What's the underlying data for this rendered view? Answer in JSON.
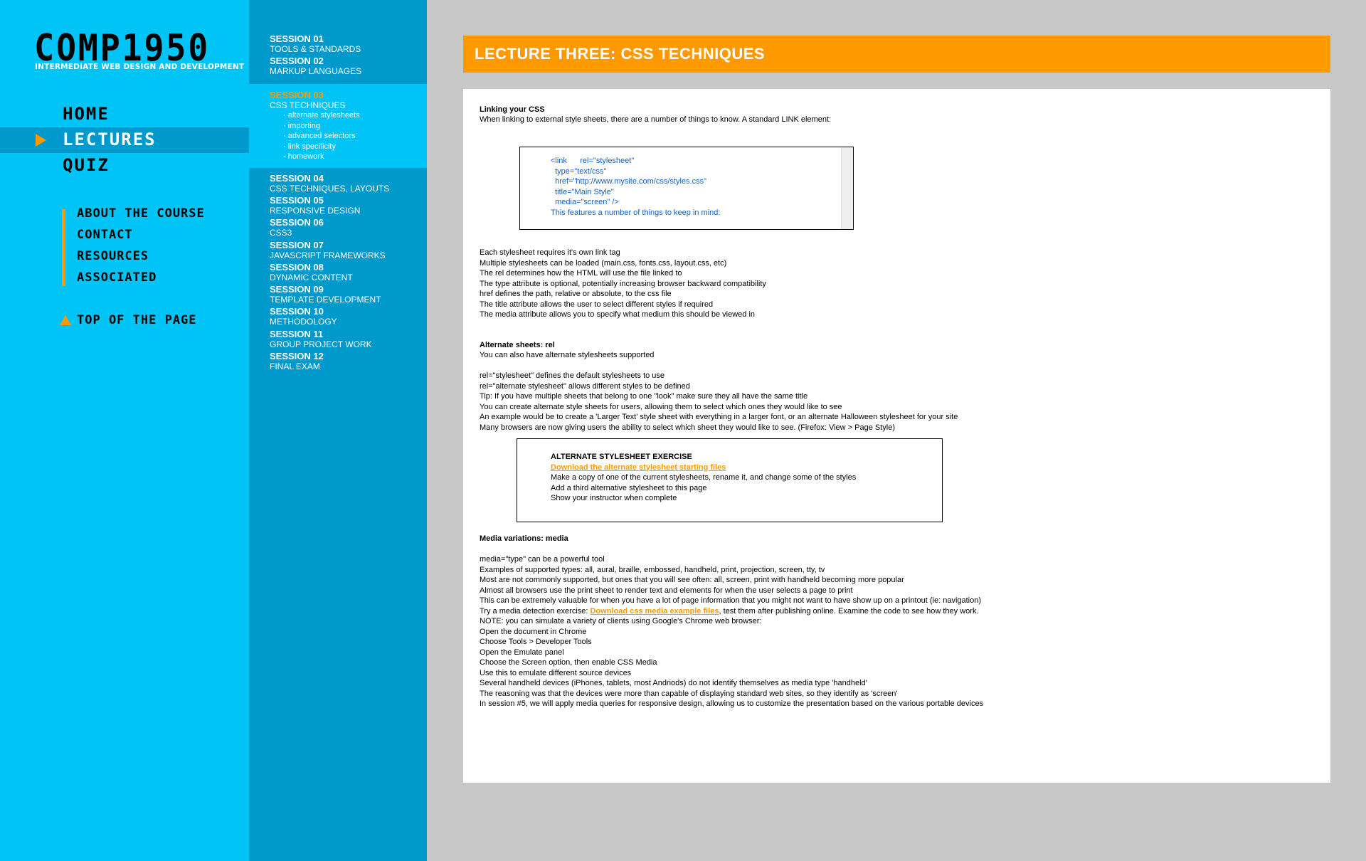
{
  "logo": {
    "title": "COMP1950",
    "subtitle": "INTERMEDIATE WEB DESIGN AND DEVELOPMENT"
  },
  "main_nav": [
    {
      "label": "HOME",
      "active": false
    },
    {
      "label": "LECTURES",
      "active": true
    },
    {
      "label": "QUIZ",
      "active": false
    }
  ],
  "sub_nav": [
    "ABOUT THE COURSE",
    "CONTACT",
    "RESOURCES",
    "ASSOCIATED"
  ],
  "top_link": "TOP OF THE PAGE",
  "sessions": [
    {
      "num": "SESSION 01",
      "name": "TOOLS & STANDARDS"
    },
    {
      "num": "SESSION 02",
      "name": "MARKUP LANGUAGES"
    },
    {
      "num": "SESSION 03",
      "name": "CSS TECHNIQUES"
    },
    {
      "num": "SESSION 04",
      "name": "CSS TECHNIQUES, LAYOUTS"
    },
    {
      "num": "SESSION 05",
      "name": "RESPONSIVE DESIGN"
    },
    {
      "num": "SESSION 06",
      "name": "CSS3"
    },
    {
      "num": "SESSION 07",
      "name": "JAVASCRIPT FRAMEWORKS"
    },
    {
      "num": "SESSION 08",
      "name": "DYNAMIC CONTENT"
    },
    {
      "num": "SESSION 09",
      "name": "TEMPLATE DEVELOPMENT"
    },
    {
      "num": "SESSION 10",
      "name": "METHODOLOGY"
    },
    {
      "num": "SESSION 11",
      "name": "GROUP PROJECT WORK"
    },
    {
      "num": "SESSION 12",
      "name": "FINAL EXAM"
    }
  ],
  "session_subtopics": [
    "· alternate stylesheets",
    "· importing",
    "· advanced selectors",
    "· link specificity",
    "- homework"
  ],
  "banner_title": "LECTURE THREE: CSS TECHNIQUES",
  "linking": {
    "heading": "Linking your CSS",
    "intro": "When linking to external style sheets, there are a number of things to know. A standard LINK element:",
    "code": [
      "<link      rel=\"stylesheet\"",
      "  type=\"text/css\"",
      "  href=\"http://www.mysite.com/css/styles.css\"",
      "  title=\"Main Style\"",
      "  media=\"screen\" />",
      "This features a number of things to keep in mind:"
    ],
    "points": [
      "Each stylesheet requires it's own link tag",
      "Multiple stylesheets can be loaded (main.css, fonts.css, layout.css, etc)",
      "The rel determines how the HTML will use the file linked to",
      "The type attribute is optional, potentially increasing browser backward compatibility",
      "href defines the path, relative or absolute, to the css file",
      "The title attribute allows the user to select different styles if required",
      "The media attribute allows you to specify what medium this should be viewed in"
    ]
  },
  "alternate": {
    "heading": "Alternate sheets: rel",
    "intro": "You can also have alternate stylesheets supported",
    "points": [
      "rel=\"stylesheet\" defines the default stylesheets to use",
      "rel=\"alternate stylesheet\" allows different styles to be defined",
      "Tip: If you have multiple sheets that belong to one \"look\" make sure they all have the same title",
      "You can create alternate style sheets for users, allowing them to select which ones they would like to see",
      "An example would be to create a 'Larger Text' style sheet with everything in a larger font, or an alternate Halloween stylesheet for your site",
      "Many browsers are now giving users the ability to select which sheet they would like to see. (Firefox: View > Page Style)"
    ]
  },
  "exercise": {
    "title": "ALTERNATE STYLESHEET EXERCISE",
    "link": "Download the alternate stylesheet starting files",
    "steps": [
      "Make a copy of one of the current stylesheets, rename it, and change some of the styles",
      "Add a third alternative stylesheet to this page",
      "Show your instructor when complete"
    ]
  },
  "media": {
    "heading": "Media variations: media",
    "points_before": [
      "media=\"type\" can be a powerful tool",
      "Examples of supported types: all, aural, braille, embossed, handheld, print, projection, screen, tty, tv",
      "Most are not commonly supported, but ones that you will see often: all, screen, print with handheld becoming more popular",
      "Almost all browsers use the print sheet to render text and elements for when the user selects a page to print",
      "This can be extremely valuable for when you have a lot of page information that you might not want to have show up on a printout (ie: navigation)"
    ],
    "try_prefix": "Try a media detection exercise: ",
    "try_link": "Download css media example files",
    "try_suffix": ", test them after publishing online. Examine the code to see how they work.",
    "points_after": [
      "NOTE: you can simulate a variety of clients using Google's Chrome web browser:",
      "Open the document in Chrome",
      "Choose Tools > Developer Tools",
      "Open the Emulate panel",
      "Choose the Screen option, then enable CSS Media",
      "Use this to emulate different source devices",
      "Several handheld devices (iPhones, tablets, most Andriods) do not identify themselves as media type 'handheld'",
      "The reasoning was that the devices were more than capable of displaying standard web sites, so they identify as 'screen'",
      "In session #5, we will apply media queries for responsive design, allowing us to customize the presentation based on the various portable devices"
    ]
  },
  "colors": {
    "left_bg": "#00c4f5",
    "session_bg": "#0099cc",
    "accent": "#ff9900",
    "code_text": "#1560bd",
    "page_bg": "#c8c8c8"
  }
}
